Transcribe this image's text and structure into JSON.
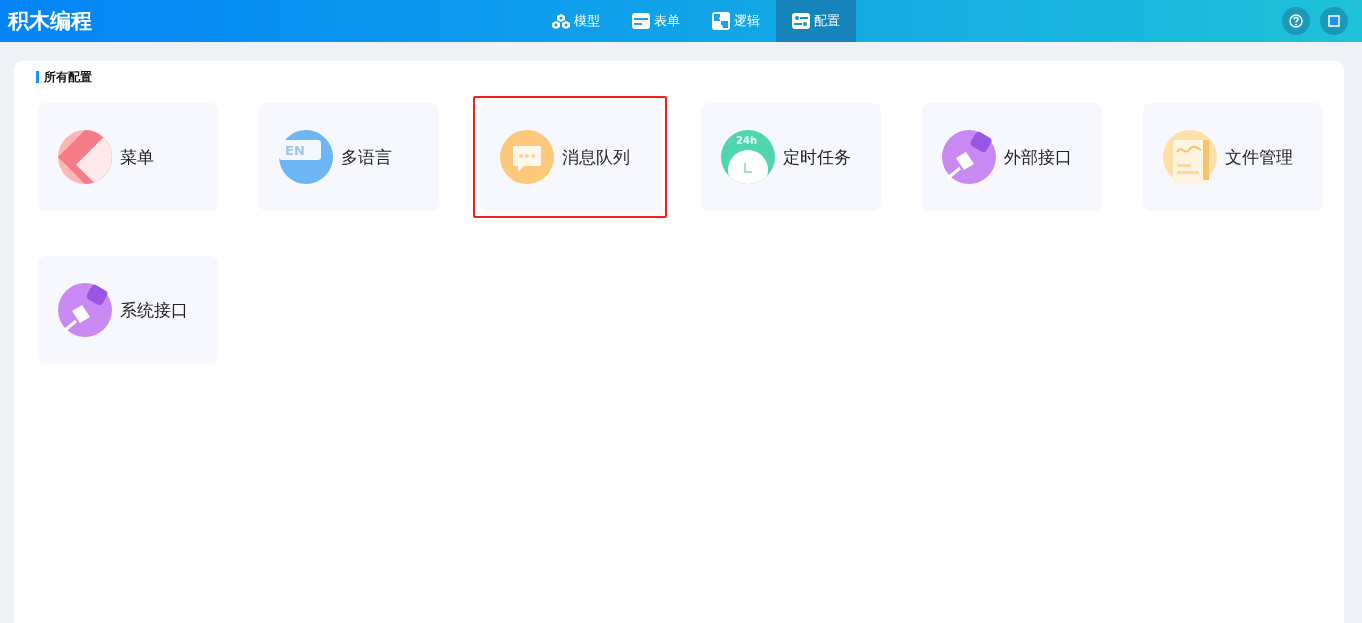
{
  "app": {
    "title": "积木编程"
  },
  "nav": [
    {
      "label": "模型",
      "selected": false
    },
    {
      "label": "表单",
      "selected": false
    },
    {
      "label": "逻辑",
      "selected": false
    },
    {
      "label": "配置",
      "selected": true
    }
  ],
  "section": {
    "title": "所有配置"
  },
  "cards": [
    {
      "label": "菜单",
      "kind": "menu",
      "highlighted": false
    },
    {
      "label": "多语言",
      "kind": "language",
      "badge": "EN",
      "highlighted": false
    },
    {
      "label": "消息队列",
      "kind": "message",
      "highlighted": true
    },
    {
      "label": "定时任务",
      "kind": "clock",
      "badge": "24h",
      "highlighted": false
    },
    {
      "label": "外部接口",
      "kind": "plug",
      "highlighted": false
    },
    {
      "label": "文件管理",
      "kind": "file",
      "highlighted": false
    },
    {
      "label": "系统接口",
      "kind": "plug",
      "highlighted": false
    }
  ]
}
